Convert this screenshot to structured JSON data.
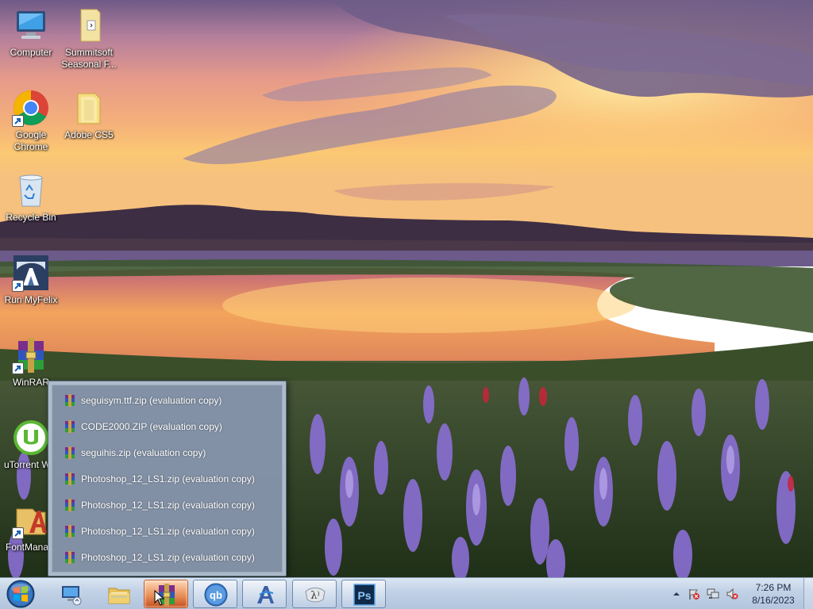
{
  "desktop": {
    "icons": [
      {
        "label": "Computer",
        "icon": "computer-icon"
      },
      {
        "label": "Summitsoft Seasonal F...",
        "icon": "folder-icon"
      },
      {
        "label": "Google Chrome",
        "icon": "chrome-icon"
      },
      {
        "label": "Adobe CS5",
        "icon": "folder-icon"
      },
      {
        "label": "Recycle Bin",
        "icon": "recycle-bin-icon"
      },
      {
        "label": "Run MyFelix",
        "icon": "myfelix-icon"
      },
      {
        "label": "WinRAR",
        "icon": "winrar-icon"
      },
      {
        "label": "uTorrent W...",
        "icon": "utorrent-icon"
      },
      {
        "label": "FontMana...",
        "icon": "fontmanager-icon"
      }
    ]
  },
  "jumplist": {
    "app": "WinRAR",
    "items": [
      {
        "label": "seguisym.ttf.zip (evaluation copy)"
      },
      {
        "label": "CODE2000.ZIP (evaluation copy)"
      },
      {
        "label": "seguihis.zip (evaluation copy)"
      },
      {
        "label": "Photoshop_12_LS1.zip (evaluation copy)"
      },
      {
        "label": "Photoshop_12_LS1.zip (evaluation copy)"
      },
      {
        "label": "Photoshop_12_LS1.zip (evaluation copy)"
      },
      {
        "label": "Photoshop_12_LS1.zip (evaluation copy)"
      }
    ]
  },
  "taskbar": {
    "buttons": [
      {
        "name": "remote-desktop",
        "icon": "remote-desktop-icon",
        "state": "pinned"
      },
      {
        "name": "file-explorer",
        "icon": "folder-icon",
        "state": "pinned"
      },
      {
        "name": "winrar",
        "icon": "winrar-icon",
        "state": "active"
      },
      {
        "name": "qbittorrent",
        "icon": "qbittorrent-icon",
        "state": "open"
      },
      {
        "name": "font-app",
        "icon": "font-icon",
        "state": "open"
      },
      {
        "name": "lambda-app",
        "icon": "lambda-icon",
        "state": "open"
      },
      {
        "name": "photoshop",
        "icon": "photoshop-icon",
        "state": "open"
      }
    ],
    "tray_icons": [
      "chevron-up-icon",
      "action-center-flag-icon",
      "network-icon",
      "volume-muted-icon"
    ],
    "clock": {
      "time": "7:26 PM",
      "date": "8/16/2023"
    }
  },
  "colors": {
    "accent_active": "#e58a52",
    "taskbar": "#c2d2e6",
    "jumplist_text": "#ffffff"
  }
}
